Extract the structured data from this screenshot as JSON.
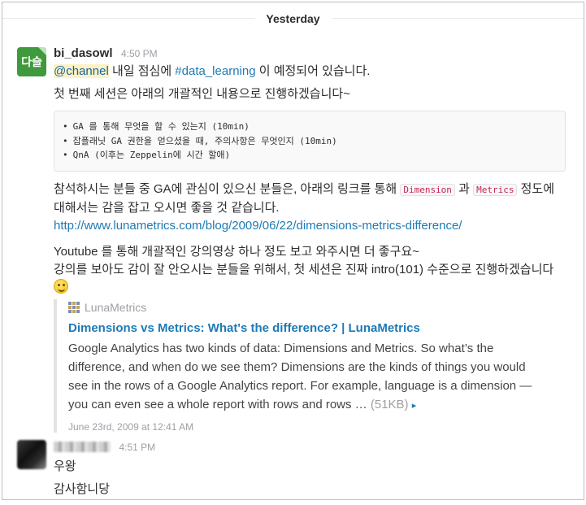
{
  "day_divider": "Yesterday",
  "messages": [
    {
      "avatar_text": "다슬",
      "sender": "bi_dasowl",
      "time": "4:50 PM",
      "line1": {
        "mention": "@channel",
        "text_a": " 내일 점심에 ",
        "channel": "#data_learning",
        "text_b": " 이 예정되어 있습니다."
      },
      "line2": "첫 번째 세션은 아래의 개괄적인 내용으로 진행하겠습니다~",
      "code_items": [
        "GA 를 통해 무엇을 할 수 있는지 (10min)",
        "잡플래닛 GA 권한을 얻으셨을 때, 주의사항은 무엇인지 (10min)",
        "QnA (이후는 Zeppelin에 시간 할애)"
      ],
      "para3": {
        "text_a": "참석하시는 분들 중 GA에 관심이 있으신 분들은, 아래의 링크를 통해 ",
        "code1": "Dimension",
        "text_b": " 과 ",
        "code2": "Metrics",
        "text_c": " 정도에 대해서는 감을 잡고 오시면 좋을 것 같습니다.",
        "url": "http://www.lunametrics.com/blog/2009/06/22/dimensions-metrics-difference/"
      },
      "para4": {
        "line1": "Youtube 를 통해 개괄적인 강의영상 하나 정도 보고 와주시면 더 좋구요~",
        "line2": "강의를 보아도 감이 잘 안오시는 분들을 위해서, 첫 세션은 진짜 intro(101) 수준으로 진행하겠습니다 ",
        "emoji": "slightly-smiling-face"
      },
      "attachment": {
        "service": "LunaMetrics",
        "title": "Dimensions vs Metrics: What's the difference? | LunaMetrics",
        "description": "Google Analytics has two kinds of data: Dimensions and Metrics. So what’s the difference, and when do we see them? Dimensions are the kinds of things you would see in the rows of a Google Analytics report.  For example, language is a dimension — you can even see a whole report with rows and rows … ",
        "size": "(51KB)",
        "more_icon": "▸",
        "footer": "June 23rd, 2009 at 12:41 AM"
      }
    },
    {
      "sender": "",
      "time": "4:51 PM",
      "lines": [
        "우왕",
        "감사함니당"
      ]
    }
  ],
  "colors": {
    "link": "#1d7ab5",
    "bot_avatar": "#3e9a3c",
    "code_text": "#c7254e"
  }
}
